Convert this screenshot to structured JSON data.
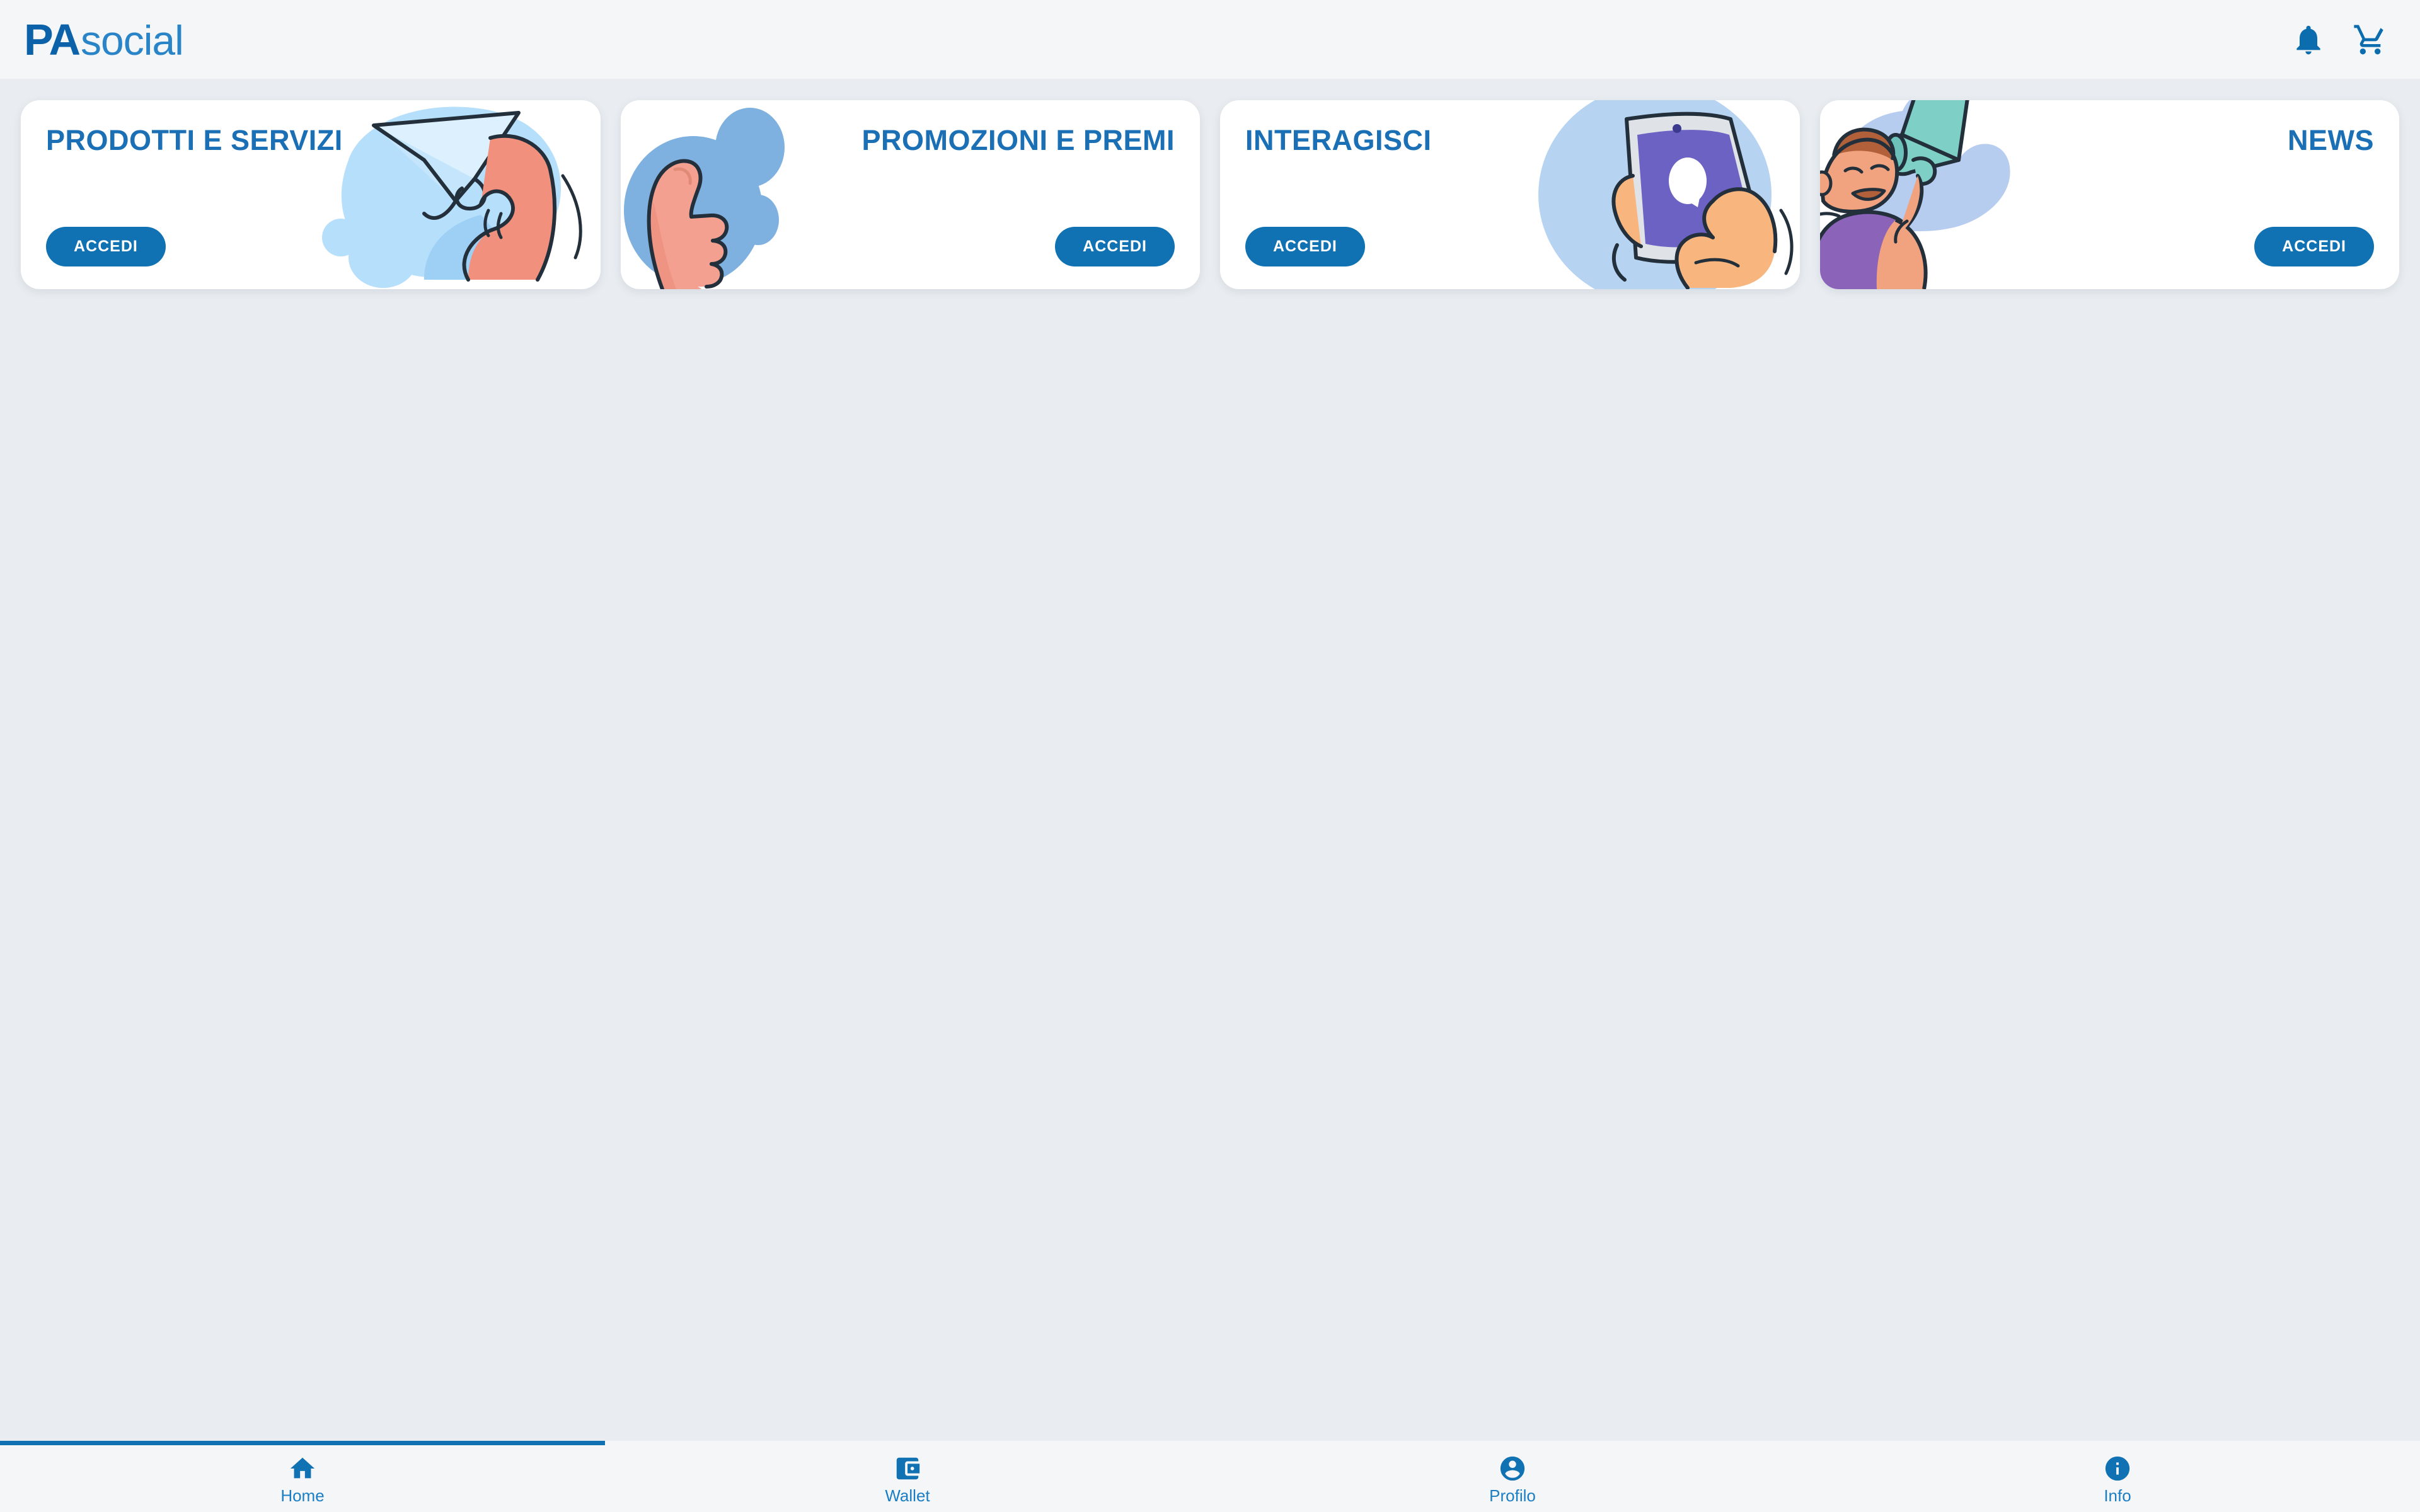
{
  "header": {
    "logo_primary": "PA",
    "logo_secondary": "social",
    "icons": [
      {
        "name": "notifications-icon",
        "label": "notifications-bell"
      },
      {
        "name": "cart-icon",
        "label": "shopping-cart"
      }
    ]
  },
  "colors": {
    "brand_blue": "#1072b3",
    "logo_dark": "#0b62a8",
    "logo_light": "#2a84c8",
    "title_blue": "#1a6fb5",
    "page_bg": "#e9edf1",
    "bar_bg": "#f5f6f7",
    "card_bg": "#ffffff",
    "nav_label": "#1b7ec4"
  },
  "main": {
    "cards": [
      {
        "id": "prodotti-e-servizi",
        "title": "PRODOTTI E SERVIZI",
        "button_label": "ACCEDI",
        "text_side": "left",
        "art": "paper-plane-hand-illustration"
      },
      {
        "id": "promozioni-e-premi",
        "title": "PROMOZIONI E PREMI",
        "button_label": "ACCEDI",
        "text_side": "right",
        "art": "thumbs-up-speech-bubbles-illustration"
      },
      {
        "id": "interagisci",
        "title": "INTERAGISCI",
        "button_label": "ACCEDI",
        "text_side": "left",
        "art": "hand-holding-smartphone-illustration"
      },
      {
        "id": "news",
        "title": "NEWS",
        "button_label": "ACCEDI",
        "text_side": "right",
        "art": "person-with-megaphone-illustration"
      }
    ]
  },
  "bottom_nav": {
    "active_index": 0,
    "items": [
      {
        "label": "Home",
        "icon": "home-icon",
        "active": true
      },
      {
        "label": "Wallet",
        "icon": "wallet-icon",
        "active": false
      },
      {
        "label": "Profilo",
        "icon": "account-icon",
        "active": false
      },
      {
        "label": "Info",
        "icon": "info-icon",
        "active": false
      }
    ]
  }
}
